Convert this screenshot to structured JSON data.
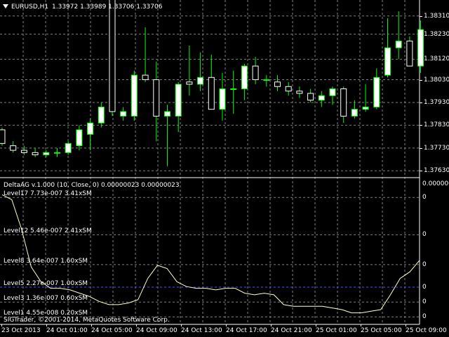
{
  "main_chart": {
    "symbol_info": "EURUSD,H1",
    "ohlc_text": "1.33972 1.33989 1.33706 1.33706",
    "price_labels": [
      "1.38310",
      "1.38230",
      "1.38120",
      "1.38030",
      "1.37930",
      "1.37830",
      "1.37730",
      "1.37630"
    ]
  },
  "indicator": {
    "title": "DeltaAG v.1.000 (10, Close, 0) 0.00000023 0.00000023",
    "top_right_value": "0.0000000",
    "levels": [
      "Level17 7.73e-007 3.41xSM",
      "Level12 5.46e-007 2.41xSM",
      "Level8 3.64e-007 1.60xSM",
      "Level5 2.27e-007 1.00xSM",
      "Level3 1.36e-007 0.60xSM",
      "Level1 4.55e-008 0.20xSM"
    ],
    "right_zero": "0",
    "copyright": "SIGTrader, ©2001-2014, MetaQuotes Software Corp."
  },
  "time_labels": [
    "23 Oct 2013",
    "24 Oct 01:00",
    "24 Oct 05:00",
    "24 Oct 09:00",
    "24 Oct 13:00",
    "24 Oct 17:00",
    "24 Oct 21:00",
    "25 Oct 01:00",
    "25 Oct 05:00",
    "25 Oct 09:00"
  ],
  "colors": {
    "background": "#000000",
    "grid": "#7f7f7f",
    "bull_candle": "#ffffff",
    "wick": "#00ff00",
    "indicator_line": "#ffffcc",
    "level_line": "#4f4fff"
  },
  "chart_data": {
    "type": "candlestick",
    "candles": [
      {
        "o": 1.3781,
        "h": 1.3782,
        "l": 1.3774,
        "c": 1.3775
      },
      {
        "o": 1.3774,
        "h": 1.3776,
        "l": 1.3771,
        "c": 1.3772
      },
      {
        "o": 1.3772,
        "h": 1.3774,
        "l": 1.377,
        "c": 1.3771
      },
      {
        "o": 1.3771,
        "h": 1.3773,
        "l": 1.3769,
        "c": 1.377
      },
      {
        "o": 1.377,
        "h": 1.3772,
        "l": 1.3769,
        "c": 1.3771
      },
      {
        "o": 1.3771,
        "h": 1.3773,
        "l": 1.3769,
        "c": 1.3771
      },
      {
        "o": 1.3771,
        "h": 1.3776,
        "l": 1.377,
        "c": 1.3775
      },
      {
        "o": 1.3774,
        "h": 1.3783,
        "l": 1.3772,
        "c": 1.3781
      },
      {
        "o": 1.3779,
        "h": 1.3786,
        "l": 1.3772,
        "c": 1.3784
      },
      {
        "o": 1.3784,
        "h": 1.3793,
        "l": 1.3782,
        "c": 1.3791
      },
      {
        "o": 1.3891,
        "h": 1.3792,
        "l": 1.3787,
        "c": 1.3789
      },
      {
        "o": 1.3787,
        "h": 1.3791,
        "l": 1.3785,
        "c": 1.3789
      },
      {
        "o": 1.3787,
        "h": 1.3807,
        "l": 1.3785,
        "c": 1.3805
      },
      {
        "o": 1.3805,
        "h": 1.3826,
        "l": 1.3802,
        "c": 1.3803
      },
      {
        "o": 1.3803,
        "h": 1.3811,
        "l": 1.3776,
        "c": 1.3787
      },
      {
        "o": 1.3787,
        "h": 1.3792,
        "l": 1.3765,
        "c": 1.3789
      },
      {
        "o": 1.3787,
        "h": 1.3802,
        "l": 1.378,
        "c": 1.3801
      },
      {
        "o": 1.3802,
        "h": 1.3818,
        "l": 1.3796,
        "c": 1.3801
      },
      {
        "o": 1.3801,
        "h": 1.3815,
        "l": 1.3798,
        "c": 1.3804
      },
      {
        "o": 1.3804,
        "h": 1.3814,
        "l": 1.379,
        "c": 1.379
      },
      {
        "o": 1.379,
        "h": 1.3806,
        "l": 1.3785,
        "c": 1.3799
      },
      {
        "o": 1.3799,
        "h": 1.3807,
        "l": 1.3788,
        "c": 1.3799
      },
      {
        "o": 1.3799,
        "h": 1.381,
        "l": 1.3794,
        "c": 1.3809
      },
      {
        "o": 1.3809,
        "h": 1.3813,
        "l": 1.3801,
        "c": 1.3803
      },
      {
        "o": 1.3803,
        "h": 1.3805,
        "l": 1.38,
        "c": 1.3803
      },
      {
        "o": 1.3802,
        "h": 1.3805,
        "l": 1.3798,
        "c": 1.38
      },
      {
        "o": 1.38,
        "h": 1.3802,
        "l": 1.3796,
        "c": 1.3798
      },
      {
        "o": 1.3798,
        "h": 1.38,
        "l": 1.3795,
        "c": 1.3797
      },
      {
        "o": 1.3797,
        "h": 1.3799,
        "l": 1.3793,
        "c": 1.3794
      },
      {
        "o": 1.3794,
        "h": 1.3798,
        "l": 1.3791,
        "c": 1.3796
      },
      {
        "o": 1.3796,
        "h": 1.38,
        "l": 1.3792,
        "c": 1.3799
      },
      {
        "o": 1.3799,
        "h": 1.38,
        "l": 1.3784,
        "c": 1.3787
      },
      {
        "o": 1.3787,
        "h": 1.3794,
        "l": 1.3786,
        "c": 1.379
      },
      {
        "o": 1.379,
        "h": 1.3801,
        "l": 1.3789,
        "c": 1.3791
      },
      {
        "o": 1.3791,
        "h": 1.3808,
        "l": 1.379,
        "c": 1.3804
      },
      {
        "o": 1.3805,
        "h": 1.383,
        "l": 1.3804,
        "c": 1.3817
      },
      {
        "o": 1.3817,
        "h": 1.3833,
        "l": 1.3812,
        "c": 1.382
      },
      {
        "o": 1.382,
        "h": 1.3822,
        "l": 1.381,
        "c": 1.3809
      },
      {
        "o": 1.3809,
        "h": 1.3829,
        "l": 1.3806,
        "c": 1.3825
      }
    ],
    "indicator_line": [
      0.79,
      0.76,
      0.58,
      0.35,
      0.26,
      0.22,
      0.22,
      0.21,
      0.19,
      0.17,
      0.14,
      0.12,
      0.12,
      0.13,
      0.15,
      0.28,
      0.36,
      0.34,
      0.26,
      0.23,
      0.22,
      0.22,
      0.21,
      0.22,
      0.22,
      0.19,
      0.18,
      0.19,
      0.18,
      0.12,
      0.11,
      0.11,
      0.11,
      0.11,
      0.1,
      0.09,
      0.07,
      0.07,
      0.08,
      0.09,
      0.18,
      0.28,
      0.32,
      0.39
    ],
    "indicator_levels": [
      0.773,
      0.546,
      0.364,
      0.227,
      0.136,
      0.0455
    ],
    "xlabel": "",
    "ylabel": ""
  }
}
